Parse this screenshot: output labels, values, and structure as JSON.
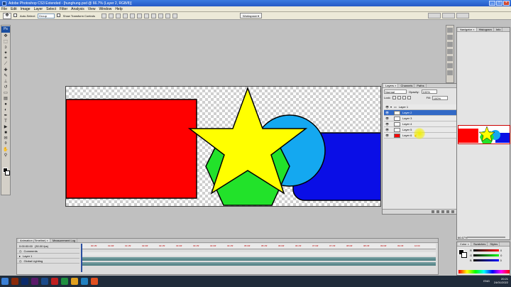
{
  "window": {
    "title": "Adobe Photoshop CS3 Extended - [hunghung.psd @ 66.7% (Layer 2, RGB/8)]",
    "controls": [
      "_",
      "□",
      "×"
    ]
  },
  "menu": [
    "File",
    "Edit",
    "Image",
    "Layer",
    "Select",
    "Filter",
    "Analysis",
    "View",
    "Window",
    "Help"
  ],
  "options": {
    "auto_select_label": "Auto-Select:",
    "auto_select_value": "Group",
    "show_transform_label": "Show Transform Controls",
    "workspace_label": "Workspace ▾"
  },
  "toolbox": {
    "logo": "Ps"
  },
  "layers_panel": {
    "tabs": [
      "Layers ×",
      "Channels",
      "Paths"
    ],
    "blend_mode": "Normal",
    "opacity_label": "Opacity:",
    "opacity_value": "100%",
    "lock_label": "Lock:",
    "fill_label": "Fill:",
    "fill_value": "100%",
    "layers": [
      {
        "name": "Layer 1",
        "selected": false,
        "group": true
      },
      {
        "name": "Layer 2",
        "selected": true,
        "group": false
      },
      {
        "name": "Layer 3",
        "selected": false,
        "group": false
      },
      {
        "name": "Layer 4",
        "selected": false,
        "group": false
      },
      {
        "name": "Layer 5",
        "selected": false,
        "group": false
      },
      {
        "name": "Layer 6",
        "selected": false,
        "group": false
      }
    ]
  },
  "navigator_panel": {
    "tabs": [
      "Navigator ×",
      "Histogram",
      "Info"
    ],
    "zoom": "66.67%"
  },
  "color_panel": {
    "tabs": [
      "Color ×",
      "Swatches",
      "Styles"
    ],
    "channels": [
      "R",
      "G",
      "B"
    ],
    "values": [
      "0",
      "0",
      "0"
    ]
  },
  "animation_panel": {
    "tabs": [
      "Animation (Timeline) ×",
      "Measurement Log"
    ],
    "timecode": "0:00:00:00",
    "fps": "(30.00 fps)",
    "rows": [
      "Comments",
      "Layer 1",
      "Global Lighting"
    ],
    "ticks": [
      "00:15f",
      "01:00f",
      "01:15f",
      "02:00f",
      "02:15f",
      "03:00f",
      "03:15f",
      "04:00f",
      "04:15f",
      "05:00f",
      "05:15f",
      "06:00f",
      "06:15f",
      "07:00f",
      "07:15f",
      "08:00f",
      "08:15f",
      "09:00f",
      "09:15f",
      "10:00"
    ]
  },
  "taskbar": {
    "lang": "ENG",
    "time": "20:21",
    "date": "24/01/2022"
  },
  "colors": {
    "red": "#ff0000",
    "yellow": "#ffff00",
    "green": "#22e22a",
    "cyan": "#14a8f0",
    "blue": "#0a0ee6",
    "selection": "#3169c6"
  }
}
